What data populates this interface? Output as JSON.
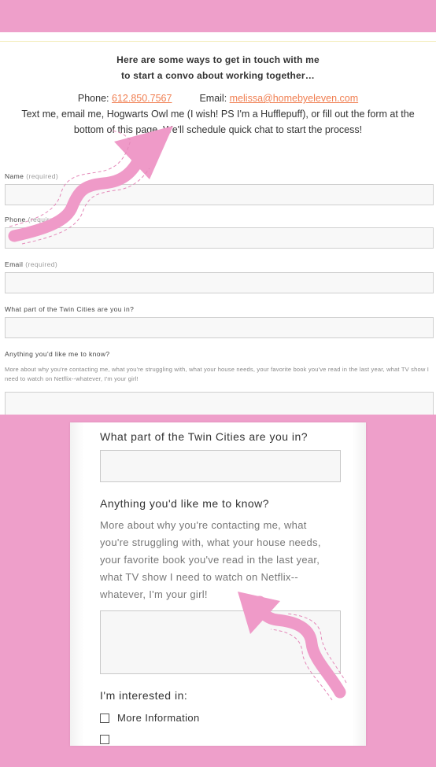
{
  "intro": {
    "heading_line1": "Here are some ways to get in touch with me",
    "heading_line2": "to start a convo about working together…",
    "phone_label": "Phone:",
    "phone_value": "612.850.7567",
    "email_label": "Email:",
    "email_value": "melissa@homebyeleven.com",
    "paragraph_line1": "Text me, email me, Hogwarts Owl me (I wish! PS I'm a Hufflepuff), or fill out the form at the",
    "paragraph_line2": "bottom of this page. We'll schedule quick chat to start the process!"
  },
  "form": {
    "name_label": "Name",
    "phone_label": "Phone",
    "email_label": "Email",
    "required_text": "(required)",
    "area_label": "What part of the Twin Cities are you in?",
    "anything_label": "Anything you'd like me to know?",
    "anything_help": "More about why you're contacting me, what you're struggling with, what your house needs, your favorite book you've read in the last year, what TV show I need to watch on Netflix--whatever, I'm your girl!"
  },
  "zoom": {
    "area_label": "What part of the Twin Cities are you in?",
    "anything_label": "Anything you'd like me to know?",
    "help_lines": [
      "More about why you're contacting me, what",
      "you're struggling with, what your house needs,",
      "your favorite book you've read in the last year,",
      "what TV show I need to watch on Netflix--",
      "whatever, I'm your girl!"
    ],
    "interested_label": "I'm interested in:",
    "option_more_info": "More Information"
  },
  "colors": {
    "brand_pink": "#ee9fca",
    "link_orange": "#f07e50",
    "arrow_pink": "#ef9ac8"
  }
}
